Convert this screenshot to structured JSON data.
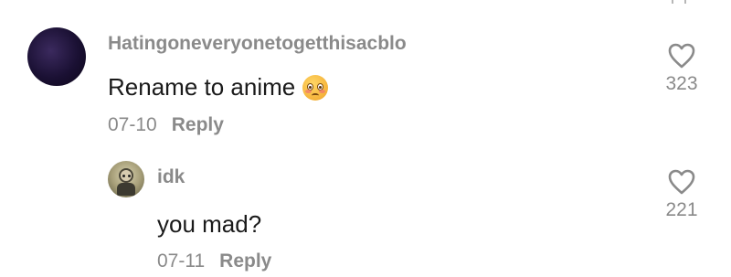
{
  "comments": [
    {
      "username": "Hatingoneveryonetogetthisacblo",
      "text": "Rename to anime",
      "emoji": "pleading-face-emoji",
      "date": "07-10",
      "reply_label": "Reply",
      "likes": "323"
    }
  ],
  "replies": [
    {
      "username": "idk",
      "text": "you mad?",
      "date": "07-11",
      "reply_label": "Reply",
      "likes": "221"
    }
  ],
  "colors": {
    "muted_text": "#8a8a8a",
    "body_text": "#1a1a1a",
    "background": "#ffffff"
  },
  "icons": {
    "like": "heart-outline-icon"
  }
}
